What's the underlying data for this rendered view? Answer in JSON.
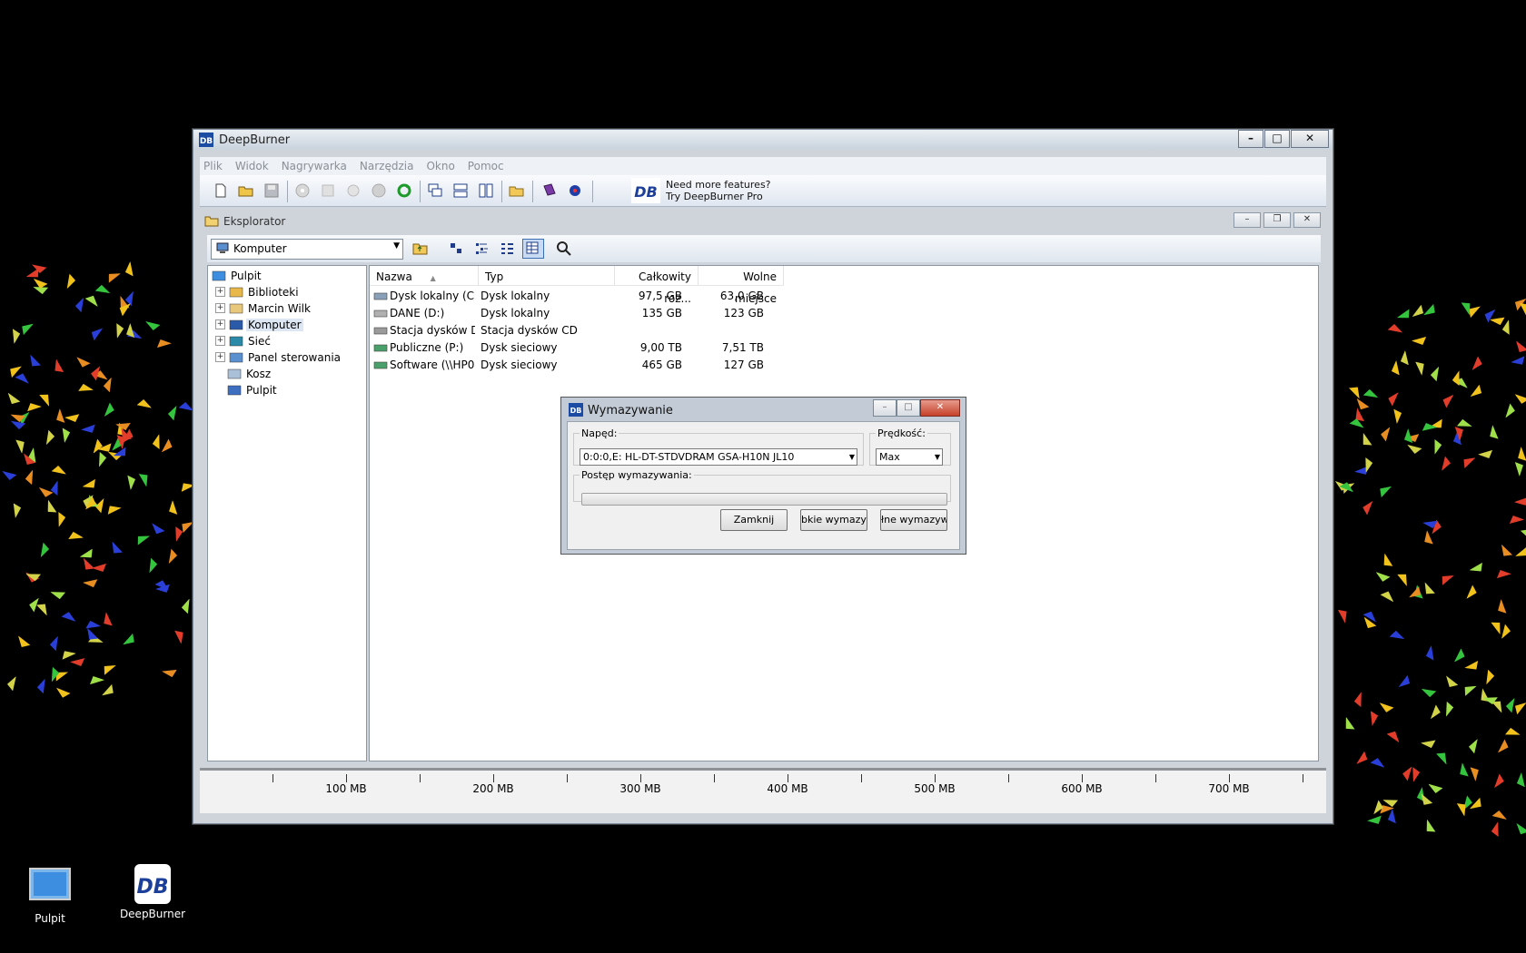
{
  "desktop": {
    "icons": [
      {
        "label": "Pulpit"
      },
      {
        "label": "DeepBurner"
      }
    ]
  },
  "window": {
    "title": "DeepBurner",
    "menu": [
      "Plik",
      "Widok",
      "Nagrywarka",
      "Narzędzia",
      "Okno",
      "Pomoc"
    ],
    "promo_line1": "Need more features?",
    "promo_line2": "Try DeepBurner Pro"
  },
  "explorer": {
    "title": "Eksplorator",
    "location": "Komputer",
    "tree": [
      {
        "label": "Pulpit",
        "expander": ""
      },
      {
        "label": "Biblioteki",
        "expander": "+"
      },
      {
        "label": "Marcin Wilk",
        "expander": "+"
      },
      {
        "label": "Komputer",
        "expander": "+"
      },
      {
        "label": "Sieć",
        "expander": "+"
      },
      {
        "label": "Panel sterowania",
        "expander": "+"
      },
      {
        "label": "Kosz",
        "expander": ""
      },
      {
        "label": "Pulpit",
        "expander": ""
      }
    ],
    "columns": [
      "Nazwa",
      "Typ",
      "Całkowity roz...",
      "Wolne miejsce"
    ],
    "rows": [
      {
        "name": "Dysk lokalny (C:)",
        "type": "Dysk lokalny",
        "total": "97,5 GB",
        "free": "63,0 GB"
      },
      {
        "name": "DANE (D:)",
        "type": "Dysk lokalny",
        "total": "135 GB",
        "free": "123 GB"
      },
      {
        "name": "Stacja dysków D...",
        "type": "Stacja dysków CD",
        "total": "",
        "free": ""
      },
      {
        "name": "Publiczne (P:)",
        "type": "Dysk sieciowy",
        "total": "9,00 TB",
        "free": "7,51 TB"
      },
      {
        "name": "Software (\\\\HP0...",
        "type": "Dysk sieciowy",
        "total": "465 GB",
        "free": "127 GB"
      }
    ]
  },
  "ruler": {
    "labels": [
      "100 MB",
      "200 MB",
      "300 MB",
      "400 MB",
      "500 MB",
      "600 MB",
      "700 MB"
    ]
  },
  "dialog": {
    "title": "Wymazywanie",
    "drive_label": "Napęd:",
    "drive_value": "0:0:0,E: HL-DT-STDVDRAM GSA-H10N JL10",
    "speed_label": "Prędkość:",
    "speed_value": "Max",
    "progress_label": "Postęp wymazywania:",
    "progress": 0,
    "btn_close": "Zamknij",
    "btn_quick": "bkie wymazyw.",
    "btn_full": "łne wymazywa"
  }
}
